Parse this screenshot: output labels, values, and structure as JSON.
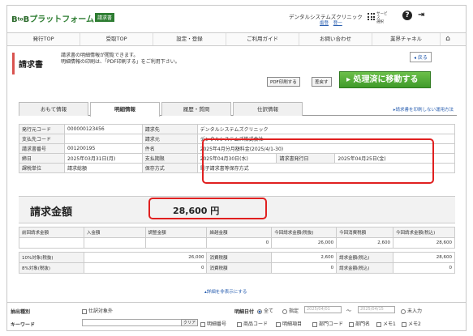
{
  "header": {
    "logo_b": "B",
    "logo_to": "to",
    "logo_b2": "B",
    "logo_rest": "プラットフォーム",
    "logo_badge": "請求書",
    "company": "デンタルシステムズクリニック",
    "company_link1": "歯登",
    "company_link2": "登一",
    "service_label_1": "サービス",
    "service_label_2": "選択",
    "help_icon": "?",
    "logout_icon": "⇥"
  },
  "nav": {
    "items": [
      "発行TOP",
      "受取TOP",
      "設定・登録",
      "ご利用ガイド",
      "お問い合わせ",
      "業界チャネル"
    ]
  },
  "page": {
    "title": "請求書",
    "desc_line1": "請求書の明細情報が閲覧できます。",
    "desc_line2": "明細情報の印刷は、「PDF印刷する」をご利用下さい。",
    "back_label": "◂ 戻る",
    "pdf_label": "PDF印刷する",
    "reject_label": "差戻す",
    "move_label": "▸ 処理済に移動する"
  },
  "tabs": {
    "items": [
      "おもて情報",
      "明細情報",
      "履歴・質問",
      "仕訳情報"
    ],
    "help_link": "▸請求書を印刷しない運用方法"
  },
  "info": {
    "r1": {
      "k1": "発行元コード",
      "v1": "000000123456",
      "k2": "請求先",
      "v2": "デンタルシステムズクリニック"
    },
    "r2": {
      "k1": "支払先コード",
      "v1": "",
      "k2": "請求元",
      "v2": "デンタルシステムズ株式会社"
    },
    "r3": {
      "k1": "請求書番号",
      "v1": "001200195",
      "k2": "件名",
      "v2": "2025年4月分月額料金(2025/4/1-30)"
    },
    "r4": {
      "k1": "締日",
      "v1": "2025年03月31日(月)",
      "k2": "支払期限",
      "v2": "2025年04月30日(水)",
      "k3": "請求書発行日",
      "v3": "2025年04月25日(金)"
    },
    "r5": {
      "k1": "課税単位",
      "v1": "請求総額",
      "k2": "保存方式",
      "v2": "電子請求書等保存方式"
    }
  },
  "amount": {
    "label": "請求金額",
    "value": "28,600 円"
  },
  "summary": {
    "headers": [
      "前回請求金額",
      "入金額",
      "調整金額",
      "繰越金額",
      "今回請求金額(税抜)",
      "今回消費税額",
      "今回請求金額(税込)"
    ],
    "values": [
      "",
      "",
      "",
      "0",
      "26,000",
      "2,600",
      "28,600"
    ],
    "row10": {
      "k": "10%対象(税抜)",
      "v": "26,000",
      "k2": "消費税額",
      "v2": "2,600",
      "k3": "請求金額(税込)",
      "v3": "28,600"
    },
    "row8": {
      "k": "8%対象(税抜)",
      "v": "0",
      "k2": "消費税額",
      "v2": "0",
      "k3": "請求金額(税込)",
      "v3": "0"
    },
    "toggle": "▴詳細を非表示にする"
  },
  "filter": {
    "type_label": "抽出種別",
    "exclude_label": "仕訳対象外",
    "date_label": "明細日付",
    "all": "全て",
    "specify": "指定",
    "date_from": "2025/04/01",
    "tilde": "〜",
    "date_to": "2025/04/15",
    "undated": "未入力",
    "keyword_label": "キーワード",
    "clear_label": "クリア",
    "checks": [
      "明細番号",
      "商品コード",
      "明細項目",
      "部門コード",
      "部門名",
      "メモ1",
      "メモ2"
    ]
  },
  "colors": {
    "accent_green": "#3f9a2a",
    "highlight_red": "#e02020",
    "link_blue": "#2a5fb0"
  }
}
